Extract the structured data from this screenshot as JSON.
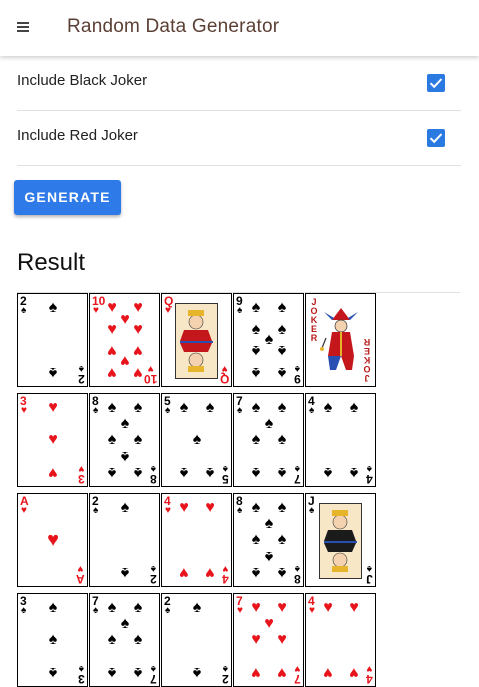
{
  "app": {
    "title": "Random Data Generator",
    "menu_icon": "hamburger-menu-icon"
  },
  "options": [
    {
      "label": "Include Black Joker",
      "checked": true
    },
    {
      "label": "Include Red Joker",
      "checked": true
    }
  ],
  "generate_label": "GENERATE",
  "result": {
    "title": "Result",
    "rows": [
      [
        {
          "rank": "2",
          "suit": "♠",
          "color": "black"
        },
        {
          "rank": "10",
          "suit": "♥",
          "color": "red"
        },
        {
          "rank": "Q",
          "suit": "♥",
          "color": "red",
          "face": "queen"
        },
        {
          "rank": "9",
          "suit": "♠",
          "color": "black"
        },
        {
          "rank": "JOKER",
          "suit": "",
          "color": "red",
          "face": "joker"
        }
      ],
      [
        {
          "rank": "3",
          "suit": "♥",
          "color": "red"
        },
        {
          "rank": "8",
          "suit": "♠",
          "color": "black"
        },
        {
          "rank": "5",
          "suit": "♠",
          "color": "black"
        },
        {
          "rank": "7",
          "suit": "♠",
          "color": "black"
        },
        {
          "rank": "4",
          "suit": "♠",
          "color": "black"
        }
      ],
      [
        {
          "rank": "A",
          "suit": "♥",
          "color": "red"
        },
        {
          "rank": "2",
          "suit": "♠",
          "color": "black"
        },
        {
          "rank": "4",
          "suit": "♥",
          "color": "red"
        },
        {
          "rank": "8",
          "suit": "♠",
          "color": "black"
        },
        {
          "rank": "J",
          "suit": "♠",
          "color": "black",
          "face": "jack"
        }
      ],
      [
        {
          "rank": "3",
          "suit": "♠",
          "color": "black"
        },
        {
          "rank": "7",
          "suit": "♠",
          "color": "black"
        },
        {
          "rank": "2",
          "suit": "♠",
          "color": "black"
        },
        {
          "rank": "7",
          "suit": "♥",
          "color": "red"
        },
        {
          "rank": "4",
          "suit": "♥",
          "color": "red"
        }
      ]
    ]
  }
}
